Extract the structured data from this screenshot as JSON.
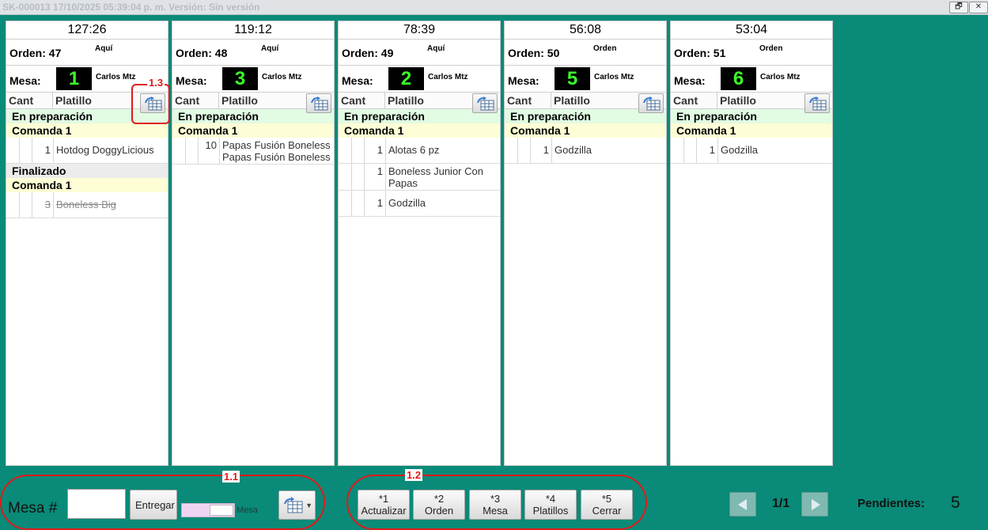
{
  "window": {
    "title": "SK-000013 17/10/2025 05:39:04 p. m. Versión: Sin versión",
    "restore_glyph": "🗗",
    "close_glyph": "✕"
  },
  "columns": {
    "qty": "Cant",
    "dish": "Platillo"
  },
  "cards": [
    {
      "time": "127:26",
      "orden": "Orden: 47",
      "location": "Aquí",
      "mesa_label": "Mesa:",
      "mesa": "1",
      "waiter": "Carlos Mtz",
      "groups": [
        {
          "status": "En preparación",
          "state": "prep",
          "comanda": "Comanda 1",
          "items": [
            {
              "qty": "1",
              "name": "Hotdog DoggyLicious"
            }
          ]
        },
        {
          "status": "Finalizado",
          "state": "fin",
          "comanda": "Comanda 1",
          "items": [
            {
              "qty": "3",
              "name": "Boneless Big"
            }
          ]
        }
      ]
    },
    {
      "time": "119:12",
      "orden": "Orden: 48",
      "location": "Aquí",
      "mesa_label": "Mesa:",
      "mesa": "3",
      "waiter": "Carlos Mtz",
      "groups": [
        {
          "status": "En preparación",
          "state": "prep",
          "comanda": "Comanda 1",
          "items": [
            {
              "qty": "10",
              "name": "Papas Fusión Boneless Papas Fusión Boneless"
            }
          ]
        }
      ]
    },
    {
      "time": "78:39",
      "orden": "Orden: 49",
      "location": "Aquí",
      "mesa_label": "Mesa:",
      "mesa": "2",
      "waiter": "Carlos Mtz",
      "groups": [
        {
          "status": "En preparación",
          "state": "prep",
          "comanda": "Comanda 1",
          "items": [
            {
              "qty": "1",
              "name": "Alotas 6 pz"
            },
            {
              "qty": "1",
              "name": "Boneless Junior Con Papas"
            },
            {
              "qty": "1",
              "name": "Godzilla"
            }
          ]
        }
      ]
    },
    {
      "time": "56:08",
      "orden": "Orden: 50",
      "location": "Orden",
      "mesa_label": "Mesa:",
      "mesa": "5",
      "waiter": "Carlos Mtz",
      "groups": [
        {
          "status": "En preparación",
          "state": "prep",
          "comanda": "Comanda 1",
          "items": [
            {
              "qty": "1",
              "name": "Godzilla"
            }
          ]
        }
      ]
    },
    {
      "time": "53:04",
      "orden": "Orden: 51",
      "location": "Orden",
      "mesa_label": "Mesa:",
      "mesa": "6",
      "waiter": "Carlos Mtz",
      "groups": [
        {
          "status": "En preparación",
          "state": "prep",
          "comanda": "Comanda 1",
          "items": [
            {
              "qty": "1",
              "name": "Godzilla"
            }
          ]
        }
      ]
    }
  ],
  "bottom": {
    "mesa_label": "Mesa #",
    "mesa_value": "",
    "deliver_label": "Entregar",
    "toggle_label": "Mesa",
    "function_keys": [
      {
        "key": "*1",
        "label": "Actualizar"
      },
      {
        "key": "*2",
        "label": "Orden"
      },
      {
        "key": "*3",
        "label": "Mesa"
      },
      {
        "key": "*4",
        "label": "Platillos"
      },
      {
        "key": "*5",
        "label": "Cerrar"
      }
    ],
    "page": "1/1",
    "pending_label": "Pendientes:",
    "pending_value": "5"
  },
  "annotations": [
    "1.1",
    "1.2",
    "1.3"
  ],
  "colors": {
    "background": "#0a8a78",
    "mesa_digit": "#3cff2a",
    "annotation": "#e01a1a",
    "prep": "#e2fbe3",
    "comanda": "#fdfdd6"
  }
}
